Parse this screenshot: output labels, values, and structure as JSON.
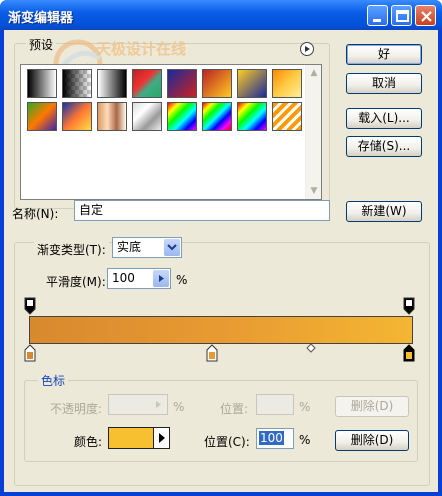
{
  "window": {
    "title": "渐变编辑器"
  },
  "presets": {
    "label": "预设",
    "swatches": [
      "linear-gradient(to right,#000,#fff)",
      "linear-gradient(to right,#000,transparent)",
      "linear-gradient(to right,#fff,#000)",
      "linear-gradient(135deg,#b22,#e33 40%,#4a8 60%,#2a6)",
      "linear-gradient(135deg,#1a2a9a,#c22)",
      "linear-gradient(135deg,#b22,#fc2)",
      "linear-gradient(135deg,#fc2,#1a2a9a)",
      "linear-gradient(135deg,#f80,#fc4,#fe9)",
      "linear-gradient(135deg,#3a2,#f70,#42a)",
      "linear-gradient(135deg,#13a,#f73,#fd4)",
      "linear-gradient(to right,#d96,#fdb,#a64,#ffe)",
      "linear-gradient(135deg,#ddd,#fff,#999,#eee)",
      "linear-gradient(135deg,#f00,#ff0,#0f0,#0ff,#00f,#f0f)",
      "linear-gradient(135deg,#f00,#ff0,#0f0,#0ff,#00f,#f0f,#f00)",
      "linear-gradient(135deg,#f00 0%,#ff0 20%,#0f0 40%,#0ff 60%,#00f 80%,#f0f 100%)",
      "repeating-linear-gradient(135deg,#f90 0 4px,#fff 4px 7px)"
    ],
    "menu_icon": "flyout-arrow-icon"
  },
  "watermark": {
    "line1": "天极设计在线",
    "line2": "Design.yesky.com"
  },
  "buttons": {
    "ok": "好",
    "cancel": "取消",
    "load": "载入(L)...",
    "save": "存储(S)...",
    "new": "新建(W)",
    "delete_opacity": "删除(D)",
    "delete_color": "删除(D)"
  },
  "name": {
    "label": "名称(N):",
    "value": "自定"
  },
  "gradient_type": {
    "label": "渐变类型(T):",
    "value": "实底"
  },
  "smoothness": {
    "label": "平滑度(M):",
    "value": "100",
    "unit": "%"
  },
  "stops": {
    "label": "色标",
    "opacity_label": "不透明度:",
    "opacity_unit": "%",
    "opacity_location_label": "位置:",
    "opacity_location_unit": "%",
    "color_label": "颜色:",
    "color_value": "#f6c030",
    "color_location_label": "位置(C):",
    "color_location_value": "100",
    "color_location_unit": "%"
  },
  "gradient": {
    "colors": [
      "#d8892e",
      "#e89a32",
      "#f3b632"
    ],
    "color_stops": [
      0,
      50,
      100
    ],
    "midpoint": 75,
    "selected_stop": 100
  }
}
